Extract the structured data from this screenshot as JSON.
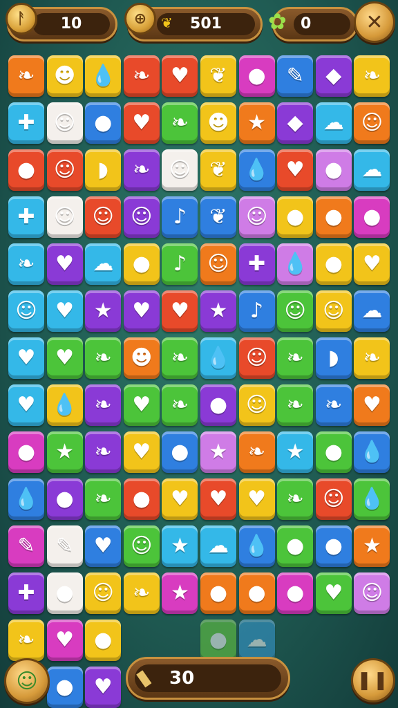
{
  "hud": {
    "left_counter": {
      "value": "10",
      "icon": "rune-icon"
    },
    "score": {
      "value": "501",
      "icon": "coin-icon",
      "sub_icon": "leaf-icon"
    },
    "right_counter": {
      "value": "0",
      "icon": "flower-icon"
    },
    "settings_icon": "tools-icon"
  },
  "footer": {
    "moves_value": "30",
    "moves_icon": "flashlight-icon",
    "pet_icon": "frog-icon",
    "pause_icon": "pause-icon"
  },
  "palette": {
    "R": "#e84a2a",
    "O": "#f07a1c",
    "Y": "#f2c41a",
    "G": "#4cc43a",
    "B": "#2f7fe0",
    "P": "#8a3ad6",
    "M": "#d83cc0",
    "C": "#34b8e8",
    "W": "#f4f0ec",
    "K": "#cf7ce6",
    "L": "#6ccf3e",
    "D": "#3a9cd8"
  },
  "board": {
    "rows": [
      [
        "O:pepper",
        "Y:frog",
        "Y:drop",
        "R:pepper",
        "R:heart",
        "Y:leaf",
        "M:berry",
        "B:feather",
        "P:gem",
        "Y:pepper"
      ],
      [
        "C:cross",
        "W:face",
        "B:berry",
        "R:heart",
        "G:pepper",
        "Y:frog",
        "O:star",
        "P:gem",
        "C:cloud",
        "O:face"
      ],
      [
        "R:apple",
        "R:face",
        "Y:fish",
        "P:pepper",
        "W:face",
        "Y:leaf",
        "B:drop",
        "R:heart",
        "K:berry",
        "C:cloud"
      ],
      [
        "C:cross",
        "W:face",
        "R:face",
        "P:ghost",
        "B:mic",
        "B:leaf",
        "K:face",
        "Y:apple",
        "O:apple",
        "M:berry"
      ],
      [
        "C:pepper",
        "P:heart",
        "C:cloud",
        "Y:apple",
        "G:mic",
        "O:face",
        "P:cross",
        "K:drop",
        "Y:apple",
        "Y:heart"
      ],
      [
        "C:face",
        "C:heart",
        "P:star",
        "P:heart",
        "R:heart",
        "P:star",
        "B:mic",
        "G:face",
        "Y:face",
        "B:cloud"
      ],
      [
        "C:heart",
        "G:heart",
        "G:pepper",
        "O:frog",
        "G:pepper",
        "C:drop",
        "R:face",
        "G:pepper",
        "B:fish",
        "Y:pepper"
      ],
      [
        "C:heart",
        "Y:drop",
        "P:pepper",
        "G:heart",
        "G:pepper",
        "P:berry",
        "Y:face",
        "G:pepper",
        "B:pepper",
        "O:heart"
      ],
      [
        "M:berry",
        "G:star",
        "P:pepper",
        "Y:heart",
        "B:berry",
        "K:star",
        "O:pepper",
        "C:star",
        "G:apple",
        "B:drop"
      ],
      [
        "B:drop",
        "P:apple",
        "G:pepper",
        "R:apple",
        "Y:heart",
        "R:heart",
        "Y:heart",
        "G:pepper",
        "R:face",
        "G:drop"
      ],
      [
        "M:feather",
        "W:feather",
        "B:heart",
        "G:face",
        "C:star",
        "C:cloud",
        "B:drop",
        "G:apple",
        "B:berry",
        "O:star"
      ],
      [
        "P:cross",
        "W:berry",
        "Y:face",
        "Y:pepper",
        "M:star",
        "O:berry",
        "O:apple",
        "M:berry",
        "G:heart",
        "K:face"
      ],
      [
        "Y:pepper",
        "M:heart",
        "Y:apple",
        "-",
        "-",
        "L:apple",
        "D:cloud",
        "-",
        "-",
        "-"
      ],
      [
        "-",
        "B:berry",
        "P:heart",
        "-",
        "-",
        "-",
        "-",
        "-",
        "-",
        "-"
      ]
    ]
  }
}
